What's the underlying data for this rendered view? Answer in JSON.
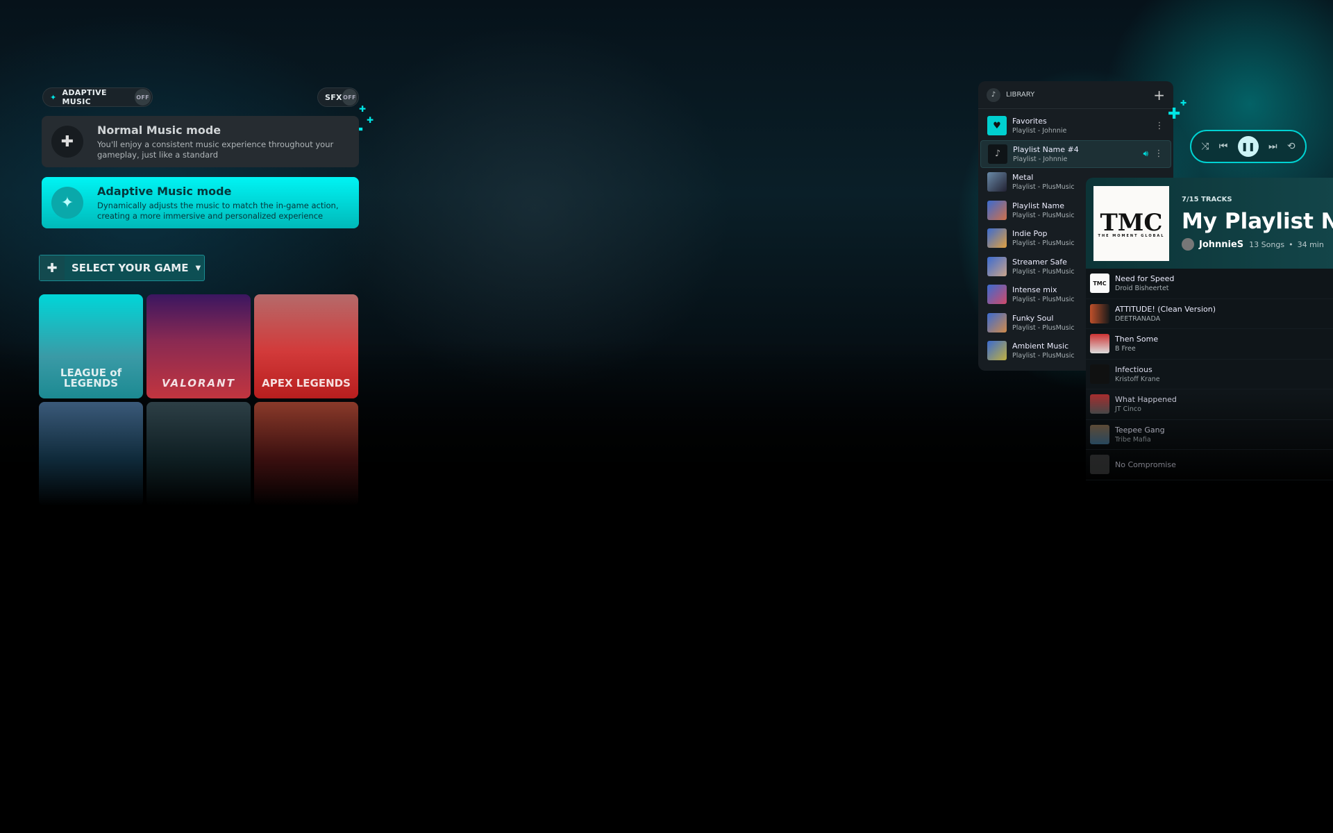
{
  "toggles": {
    "adaptive_label": "ADAPTIVE MUSIC",
    "adaptive_state": "OFF",
    "sfx_label": "SFX",
    "sfx_state": "OFF"
  },
  "modes": [
    {
      "title": "Normal Music mode",
      "desc": "You'll enjoy a consistent music experience throughout your gameplay, just like a standard",
      "selected": false
    },
    {
      "title": "Adaptive Music mode",
      "desc": "Dynamically adjusts the music to match the in-game action, creating a more immersive and personalized experience",
      "selected": true
    }
  ],
  "select_game": {
    "label": "SELECT YOUR GAME"
  },
  "games": [
    {
      "name": "LEAGUE of LEGENDS"
    },
    {
      "name": "VALORANT"
    },
    {
      "name": "APEX LEGENDS"
    },
    {
      "name": ""
    },
    {
      "name": ""
    },
    {
      "name": ""
    }
  ],
  "library": {
    "title": "LIBRARY",
    "items": [
      {
        "name": "Favorites",
        "sub": "Playlist - Johnnie"
      },
      {
        "name": "Playlist Name #4",
        "sub": "Playlist - Johnnie",
        "active": true
      },
      {
        "name": "Metal",
        "sub": "Playlist - PlusMusic"
      },
      {
        "name": "Playlist Name",
        "sub": "Playlist - PlusMusic"
      },
      {
        "name": "Indie Pop",
        "sub": "Playlist - PlusMusic"
      },
      {
        "name": "Streamer Safe",
        "sub": "Playlist - PlusMusic"
      },
      {
        "name": "Intense mix",
        "sub": "Playlist - PlusMusic"
      },
      {
        "name": "Funky Soul",
        "sub": "Playlist - PlusMusic"
      },
      {
        "name": "Ambient Music",
        "sub": "Playlist - PlusMusic"
      }
    ]
  },
  "player": {
    "state": "playing"
  },
  "playlist": {
    "tracks_count": "7/15 TRACKS",
    "title": "My Playlist Name",
    "owner": "JohnnieS",
    "songs": "13 Songs",
    "duration": "34 min",
    "art_text": "TMC",
    "art_sub": "THE MOMENT GLOBAL",
    "tracks": [
      {
        "title": "Need for Speed",
        "artist": "Droid Bisheertet"
      },
      {
        "title": "ATTITUDE! (Clean Version)",
        "artist": "DEETRANADA"
      },
      {
        "title": "Then Some",
        "artist": "B Free"
      },
      {
        "title": "Infectious",
        "artist": "Kristoff Krane"
      },
      {
        "title": "What Happened",
        "artist": "JT Cinco"
      },
      {
        "title": "Teepee Gang",
        "artist": "Tribe Mafia"
      },
      {
        "title": "No Compromise",
        "artist": ""
      }
    ]
  },
  "colors": {
    "accent": "#00e5e5"
  }
}
